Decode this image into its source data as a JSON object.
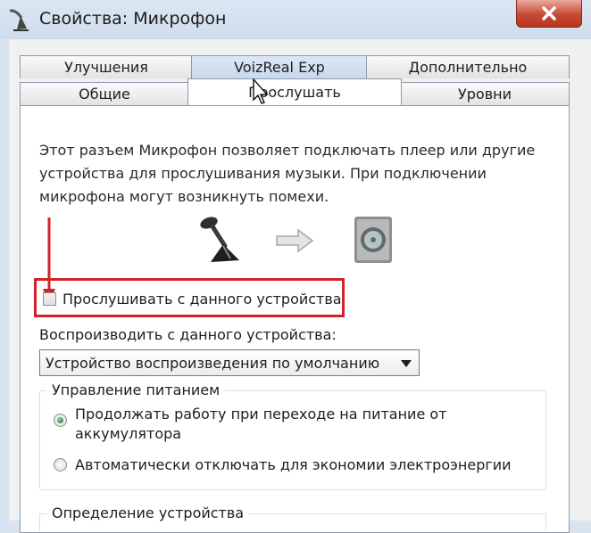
{
  "window": {
    "title": "Свойства: Микрофон"
  },
  "tabs_row1": [
    "Улучшения",
    "VoizReal Exp",
    "Дополнительно"
  ],
  "tabs_row2": [
    "Общие",
    "Прослушать",
    "Уровни"
  ],
  "active_tab": "Прослушать",
  "panel": {
    "description": "Этот разъем Микрофон позволяет подключать плеер или другие устройства для прослушивания музыки. При подключении микрофона могут возникнуть помехи.",
    "listen_checkbox_label": "Прослушивать с данного устройства",
    "listen_checked": false,
    "playback_label": "Воспроизводить с данного устройства:",
    "playback_device": "Устройство воспроизведения по умолчанию",
    "power_group_title": "Управление питанием",
    "power_option_1": "Продолжать работу при переходе на питание от аккумулятора",
    "power_option_1_selected": true,
    "power_option_2": "Автоматически отключать для экономии электроэнергии",
    "power_option_2_selected": false,
    "detection_group_title": "Определение устройства"
  },
  "colors": {
    "highlight": "#d2232a",
    "close_button": "#c74a34",
    "panel_background": "#ffffff",
    "window_frame": "#d9e4f1"
  },
  "icons": [
    "microphone-icon",
    "arrow-right-icon",
    "speaker-icon",
    "close-icon",
    "mouse-cursor-icon"
  ]
}
